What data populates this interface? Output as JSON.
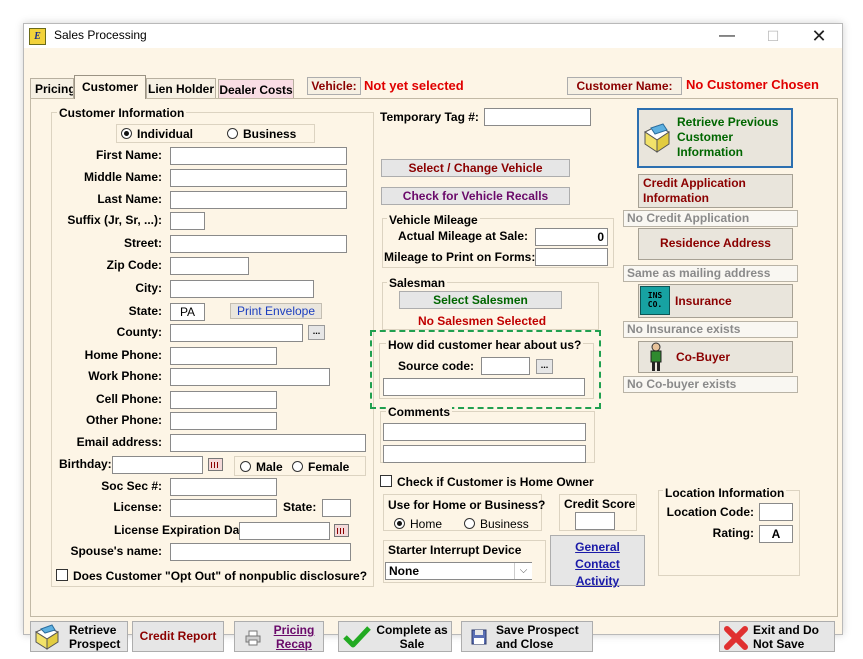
{
  "window": {
    "title": "Sales Processing",
    "logo": "E"
  },
  "tabs": [
    {
      "label": "Pricing"
    },
    {
      "label": "Customer"
    },
    {
      "label": "Lien Holder"
    },
    {
      "label": "Dealer Costs"
    }
  ],
  "header": {
    "vehicle_label": "Vehicle:",
    "vehicle_value": "Not yet selected",
    "customer_label": "Customer Name:",
    "customer_value": "No Customer Chosen"
  },
  "customer_info": {
    "title": "Customer Information",
    "individual": "Individual",
    "business": "Business",
    "first_name": "First Name:",
    "middle_name": "Middle Name:",
    "last_name": "Last Name:",
    "suffix": "Suffix (Jr, Sr, ...):",
    "street": "Street:",
    "zip": "Zip Code:",
    "city": "City:",
    "state": "State:",
    "state_value": "PA",
    "print_envelope": "Print Envelope",
    "county": "County:",
    "home_phone": "Home Phone:",
    "work_phone": "Work Phone:",
    "cell_phone": "Cell Phone:",
    "other_phone": "Other Phone:",
    "email": "Email address:",
    "birthday": "Birthday:",
    "male": "Male",
    "female": "Female",
    "soc_sec": "Soc Sec #:",
    "license": "License:",
    "license_state": "State:",
    "license_exp": "License Expiration Date:",
    "spouse": "Spouse's name:",
    "opt_out": "Does Customer \"Opt Out\" of nonpublic disclosure?"
  },
  "middle": {
    "temp_tag": "Temporary Tag #:",
    "select_vehicle": "Select / Change Vehicle",
    "check_recalls": "Check for Vehicle Recalls",
    "mileage_title": "Vehicle Mileage",
    "actual_mileage": "Actual Mileage at Sale:",
    "actual_mileage_value": "0",
    "mileage_print": "Mileage to Print on Forms:",
    "salesman_title": "Salesman",
    "select_salesmen": "Select Salesmen",
    "no_salesmen": "No Salesmen Selected",
    "hear_title": "How did customer hear about us?",
    "source_code": "Source code:",
    "comments": "Comments",
    "home_owner": "Check if Customer is Home Owner",
    "use_title": "Use for Home or Business?",
    "use_home": "Home",
    "use_business": "Business",
    "credit_score": "Credit Score",
    "starter_title": "Starter Interrupt Device",
    "starter_value": "None",
    "general_contact": "General Contact Activity"
  },
  "right": {
    "retrieve_prev": "Retrieve Previous Customer Information",
    "credit_app": "Credit Application Information",
    "no_credit_app": "No Credit Application",
    "residence": "Residence Address",
    "same_mailing": "Same as mailing address",
    "insurance": "Insurance",
    "ins_icon_text": "INS CO.",
    "no_insurance": "No Insurance exists",
    "cobuyer": "Co-Buyer",
    "no_cobuyer": "No Co-buyer exists",
    "location_title": "Location Information",
    "location_code": "Location Code:",
    "rating": "Rating:",
    "rating_value": "A"
  },
  "bottom": {
    "retrieve_prospect": "Retrieve Prospect",
    "credit_report": "Credit Report",
    "pricing_recap": "Pricing Recap",
    "complete_sale": "Complete as Sale",
    "save_prospect": "Save Prospect and Close",
    "exit": "Exit and Do Not Save"
  },
  "colors": {
    "background": "#fdf5e6",
    "accent_red": "#e00000",
    "accent_green": "#006600",
    "accent_darkred": "#8b0000"
  }
}
